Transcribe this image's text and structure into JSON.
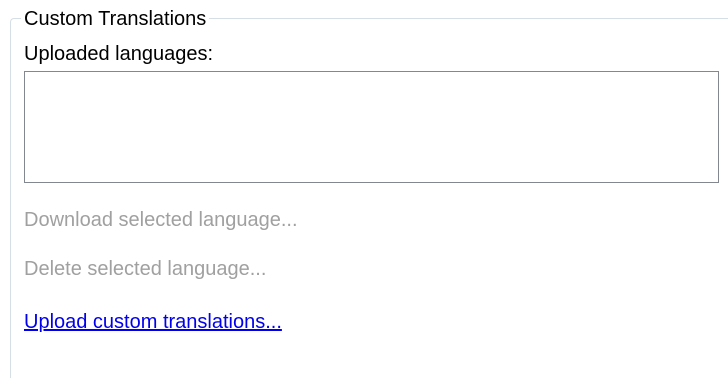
{
  "group": {
    "title": "Custom Translations",
    "list_label": "Uploaded languages:",
    "languages": []
  },
  "actions": {
    "download": {
      "label": "Download selected language...",
      "enabled": false
    },
    "delete": {
      "label": "Delete selected language...",
      "enabled": false
    },
    "upload": {
      "label": "Upload custom translations...",
      "enabled": true
    }
  },
  "colors": {
    "disabled_text": "#a0a0a0",
    "link": "#0000ee",
    "list_border": "#828790",
    "group_border": "#d5dfe5"
  }
}
